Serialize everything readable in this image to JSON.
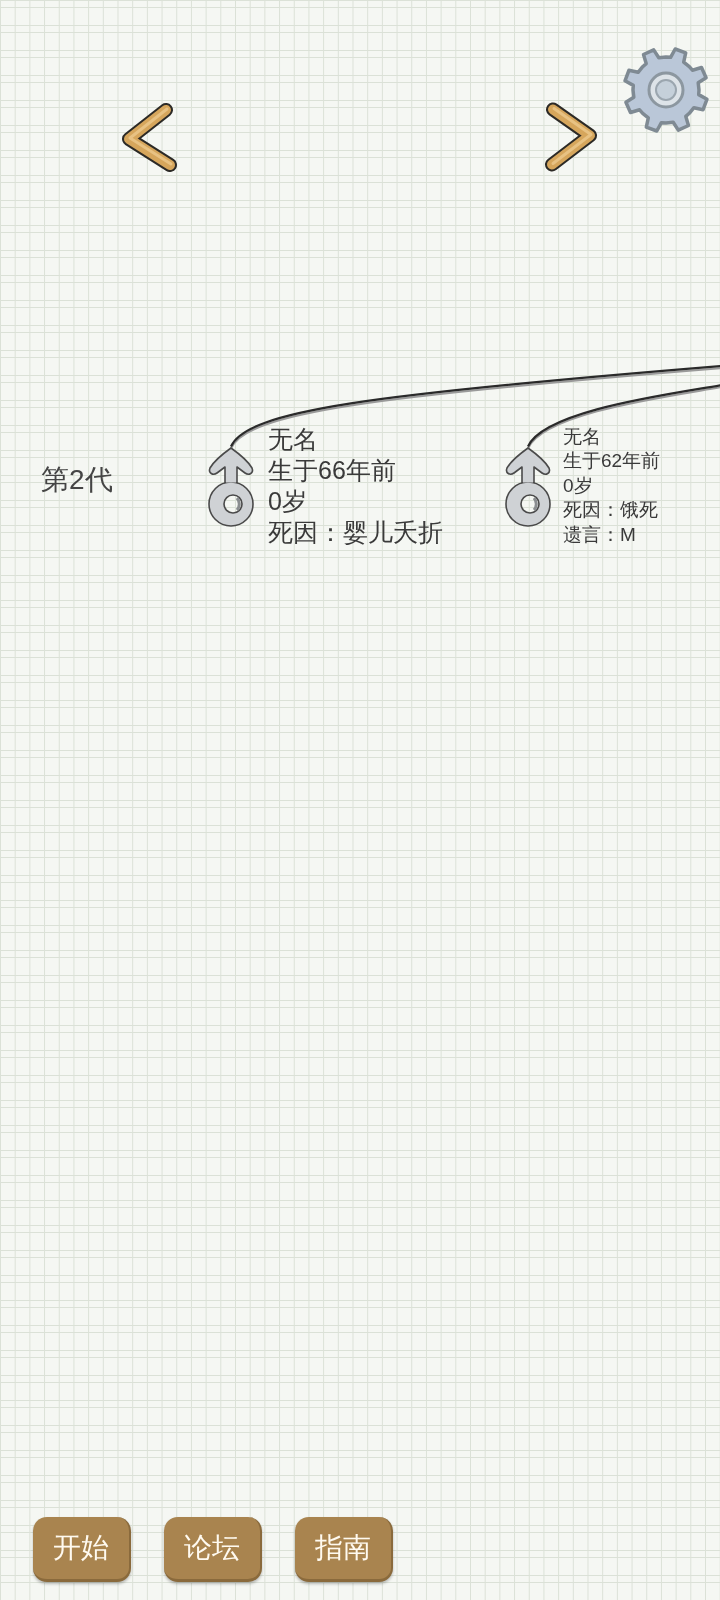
{
  "generations": [
    {
      "label": "第2代",
      "members": [
        {
          "kind": "male",
          "name": "无名",
          "born": "生于66年前",
          "age": "0岁",
          "cause_of_death": "死因：婴儿夭折"
        },
        {
          "kind": "male",
          "name": "无名",
          "born": "生于62年前",
          "age": "0岁",
          "cause_of_death": "死因：饿死",
          "last_words": "遗言：M"
        }
      ]
    }
  ],
  "buttons": [
    "开始",
    "论坛",
    "指南"
  ]
}
